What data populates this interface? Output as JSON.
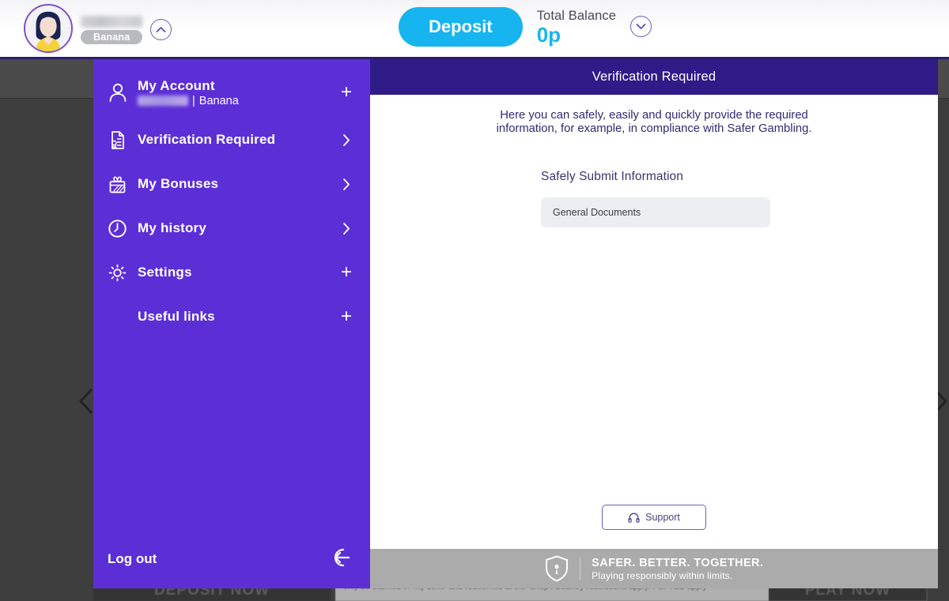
{
  "header": {
    "username_redacted": true,
    "badge": "Banana",
    "collapse_icon": "chevron-up-icon",
    "deposit_label": "Deposit",
    "balance_label": "Total Balance",
    "balance_value": "0p",
    "balance_expand_icon": "chevron-down-icon"
  },
  "menu": {
    "items": [
      {
        "label": "My Account",
        "icon": "person-icon",
        "affordance": "plus",
        "sub_separator": "|",
        "sub_text": "Banana",
        "sub_redacted": true
      },
      {
        "label": "Verification Required",
        "icon": "document-badge-icon",
        "affordance": "chevron"
      },
      {
        "label": "My Bonuses",
        "icon": "gift-icon",
        "affordance": "chevron"
      },
      {
        "label": "My history",
        "icon": "clock-icon",
        "affordance": "chevron"
      },
      {
        "label": "Settings",
        "icon": "gear-icon",
        "affordance": "plus"
      },
      {
        "label": "Useful links",
        "icon": "none",
        "affordance": "plus"
      }
    ],
    "logout_label": "Log out",
    "logout_icon": "logout-icon"
  },
  "panel": {
    "title": "Verification Required",
    "intro": "Here you can safely, easily and quickly provide the required information, for example, in compliance with Safer Gambling.",
    "submit_title": "Safely Submit Information",
    "documents": [
      "General Documents"
    ],
    "support_label": "Support",
    "support_icon": "headset-icon"
  },
  "safer_banner": {
    "icon": "shield-icon",
    "headline": "SAFER. BETTER. TOGETHER.",
    "subline": "Playing responsibly within limits."
  },
  "background": {
    "deposit_now": "DEPOSIT NOW",
    "play_now": "PLAY NOW",
    "terms": "only be claimed in 'my zone' and redeemed at the 'Shop'. Country restrictions apply. Full T&C apply",
    "prev_icon": "chevron-left-icon",
    "next_icon": "chevron-right-icon"
  },
  "colors": {
    "menu_purple": "#5c2fd6",
    "panel_header_indigo": "#2e1b87",
    "deposit_cyan": "#16b5f0",
    "banner_gray": "#ababab",
    "text_indigo": "#2f2b76"
  }
}
